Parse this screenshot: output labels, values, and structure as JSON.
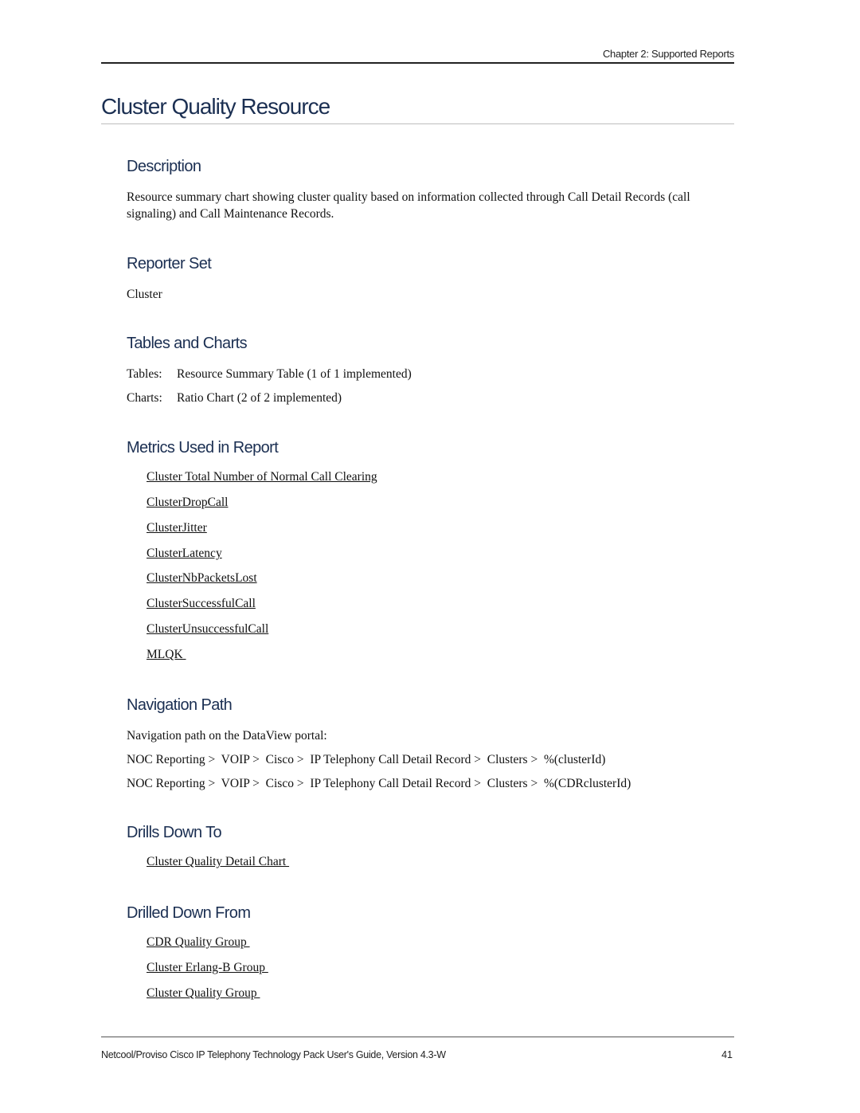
{
  "header": {
    "running_head": "Chapter 2: Supported Reports"
  },
  "title": "Cluster Quality Resource",
  "sections": {
    "description": {
      "heading": "Description",
      "text": "Resource summary chart showing cluster quality based on information collected through Call Detail Records (call signaling) and Call Maintenance Records."
    },
    "reporter_set": {
      "heading": "Reporter Set",
      "text": "Cluster"
    },
    "tables_and_charts": {
      "heading": "Tables and Charts",
      "rows": [
        {
          "label": "Tables:",
          "value": "Resource Summary Table (1 of 1 implemented)"
        },
        {
          "label": "Charts:",
          "value": "Ratio Chart (2 of 2 implemented)"
        }
      ]
    },
    "metrics": {
      "heading": "Metrics Used in Report",
      "links": [
        "Cluster Total Number of Normal Call Clearing",
        "ClusterDropCall",
        "ClusterJitter",
        "ClusterLatency",
        "ClusterNbPacketsLost",
        "ClusterSuccessfulCall",
        "ClusterUnsuccessfulCall",
        "MLQK "
      ]
    },
    "navigation_path": {
      "heading": "Navigation Path",
      "intro": "Navigation path on the DataView portal:",
      "paths": [
        "NOC Reporting >  VOIP >  Cisco >  IP Telephony Call Detail Record >  Clusters >  %(clusterId)",
        "NOC Reporting >  VOIP >  Cisco >  IP Telephony Call Detail Record >  Clusters >  %(CDRclusterId)"
      ]
    },
    "drills_down_to": {
      "heading": "Drills Down To",
      "links": [
        "Cluster Quality Detail Chart "
      ]
    },
    "drilled_down_from": {
      "heading": "Drilled Down From",
      "links": [
        "CDR Quality Group ",
        "Cluster Erlang-B Group ",
        "Cluster Quality Group "
      ]
    }
  },
  "footer": {
    "guide_title": "Netcool/Proviso Cisco IP Telephony Technology Pack User's Guide, Version 4.3-W",
    "page_number": "41"
  }
}
